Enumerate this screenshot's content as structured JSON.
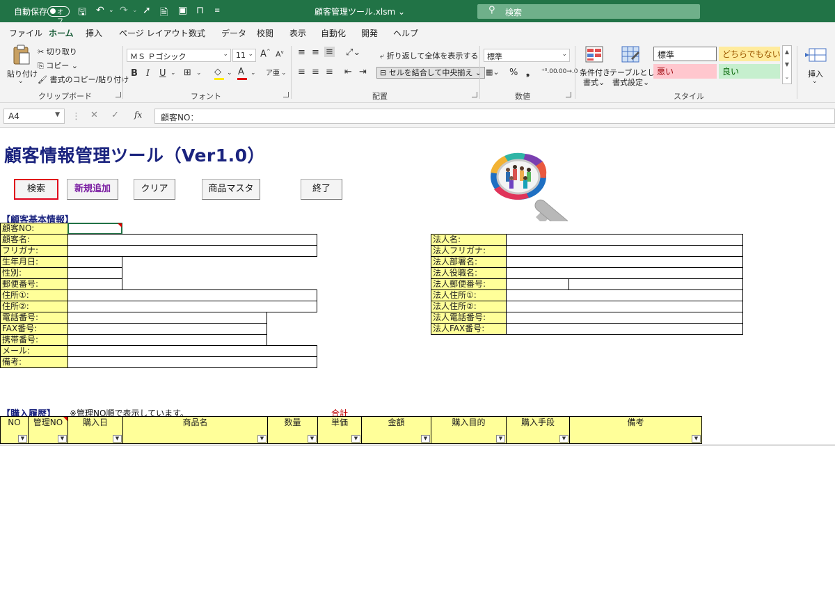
{
  "titlebar": {
    "autosave_label": "自動保存",
    "autosave_state": "オフ",
    "filename": "顧客管理ツール.xlsm",
    "search_placeholder": "検索"
  },
  "menu": [
    "ファイル",
    "ホーム",
    "挿入",
    "ページ レイアウト",
    "数式",
    "データ",
    "校閲",
    "表示",
    "自動化",
    "開発",
    "ヘルプ"
  ],
  "ribbon": {
    "clipboard": {
      "paste": "貼り付け",
      "cut": "切り取り",
      "copy": "コピー",
      "format_painter": "書式のコピー/貼り付け",
      "group": "クリップボード"
    },
    "font": {
      "name": "ＭＳ Ｐゴシック",
      "size": "11",
      "group": "フォント"
    },
    "alignment": {
      "wrap": "折り返して全体を表示する",
      "merge": "セルを結合して中央揃え",
      "group": "配置"
    },
    "number": {
      "format": "標準",
      "group": "数値"
    },
    "styles": {
      "conditional": [
        "条件付き",
        "書式"
      ],
      "table": [
        "テーブルとして",
        "書式設定"
      ],
      "cell_styles": [
        "標準",
        "どちらでもない",
        "悪い",
        "良い"
      ],
      "group": "スタイル"
    },
    "cells": {
      "insert": "挿入"
    }
  },
  "formula_bar": {
    "name_box": "A4",
    "content": "顧客NO："
  },
  "sheet": {
    "title": "顧客情報管理ツール（Ver1.0）",
    "buttons": [
      "検索",
      "新規追加",
      "クリア",
      "商品マスタ",
      "終了"
    ],
    "customer_header": "【顧客基本情報】",
    "customer_fields": [
      "顧客NO:",
      "顧客名:",
      "フリガナ:",
      "生年月日:",
      "性別:",
      "郵便番号:",
      "住所①:",
      "住所②:",
      "電話番号:",
      "FAX番号:",
      "携帯番号:",
      "メール:",
      "備考:"
    ],
    "corporate_fields": [
      "法人名:",
      "法人フリガナ:",
      "法人部署名:",
      "法人役職名:",
      "法人郵便番号:",
      "法人住所①:",
      "法人住所②:",
      "法人電話番号:",
      "法人FAX番号:"
    ],
    "purchase_header": "【購入履歴】",
    "purchase_note": "※管理NO順で表示しています。",
    "total_label": "合計",
    "table_columns": [
      "NO",
      "管理NO",
      "購入日",
      "商品名",
      "数量",
      "単価",
      "金額",
      "購入目的",
      "購入手段",
      "備考"
    ]
  },
  "colors": {
    "excel_green": "#217346",
    "field_label_bg": "#ffff99",
    "title_color": "#1a237e",
    "selected_border": "#e0001b"
  }
}
